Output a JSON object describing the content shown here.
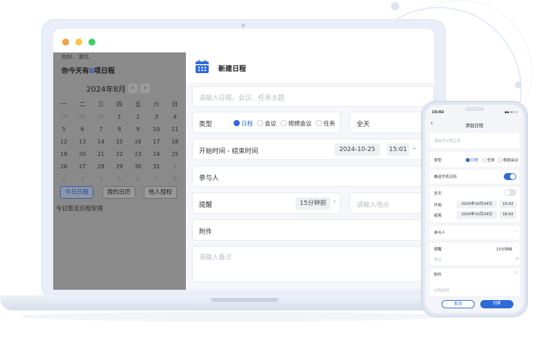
{
  "laptop": {
    "left": {
      "greeting": "你好，湘北",
      "summary_prefix": "你今天有",
      "summary_count": "0",
      "summary_suffix": "项日程",
      "month_title": "2024年8月",
      "weekdays": [
        "一",
        "二",
        "三",
        "四",
        "五",
        "六",
        "日"
      ],
      "days": [
        [
          "29",
          "muted"
        ],
        [
          "30",
          "muted"
        ],
        [
          "31",
          "muted"
        ],
        [
          "1",
          ""
        ],
        [
          "2",
          ""
        ],
        [
          "3",
          ""
        ],
        [
          "4",
          ""
        ],
        [
          "5",
          ""
        ],
        [
          "6",
          ""
        ],
        [
          "7",
          ""
        ],
        [
          "8",
          ""
        ],
        [
          "9",
          ""
        ],
        [
          "10",
          ""
        ],
        [
          "11",
          ""
        ],
        [
          "12",
          ""
        ],
        [
          "13",
          ""
        ],
        [
          "14",
          ""
        ],
        [
          "15",
          ""
        ],
        [
          "16",
          ""
        ],
        [
          "17",
          ""
        ],
        [
          "18",
          ""
        ],
        [
          "19",
          ""
        ],
        [
          "20",
          ""
        ],
        [
          "21",
          ""
        ],
        [
          "22",
          ""
        ],
        [
          "23",
          ""
        ],
        [
          "24",
          ""
        ],
        [
          "25",
          ""
        ],
        [
          "26",
          ""
        ],
        [
          "27",
          ""
        ],
        [
          "28",
          ""
        ],
        [
          "29",
          ""
        ],
        [
          "30",
          ""
        ],
        [
          "31",
          ""
        ],
        [
          "1",
          "muted"
        ],
        [
          "2",
          "muted"
        ],
        [
          "3",
          "muted"
        ],
        [
          "4",
          "muted"
        ],
        [
          "5",
          "muted"
        ],
        [
          "6",
          "muted"
        ],
        [
          "7",
          "muted"
        ],
        [
          "8",
          "muted"
        ]
      ],
      "buttons": {
        "today": "今日日程",
        "mine": "我的日历",
        "others": "他人授权"
      },
      "empty_text": "今日暂无日程安排"
    },
    "form": {
      "title": "新建日程",
      "subject_placeholder": "请输入日程、会议、任务主题",
      "type_label": "类型",
      "type_options": {
        "schedule": "日程",
        "meeting": "会议",
        "video": "视频会议",
        "task": "任务"
      },
      "allday_label": "全天",
      "time_label": "开始时间 - 结束时间",
      "start_date": "2024-10-25",
      "start_time": "15:01",
      "time_sep": "-",
      "participants_label": "参与人",
      "reminder_label": "提醒",
      "reminder_value": "15分钟前",
      "location_placeholder": "请输入地点",
      "attachment_label": "附件",
      "notes_placeholder": "请输入备注"
    }
  },
  "phone": {
    "status_time": "15:02",
    "status_icons": "▪▪ ≋ ▭",
    "back_icon": "‹",
    "title": "添加日程",
    "subject_placeholder": "请填写日程主题",
    "type_label": "类型",
    "type_options": {
      "schedule": "日程",
      "task": "任务",
      "video": "视频会议"
    },
    "sync_label": "推送手机日历",
    "allday_label": "全天",
    "start_label": "开始",
    "start_date": "2024年10月24日",
    "start_time": "15:02",
    "end_label": "结束",
    "end_date": "2024年10月24日",
    "end_time": "16:02",
    "participants_label": "参与人",
    "reminder_label": "提醒",
    "reminder_value": "15分钟前",
    "location_placeholder": "地点",
    "attachment_label": "附件",
    "notes_placeholder": "日程说明",
    "cancel_label": "取消",
    "create_label": "创建"
  },
  "colors": {
    "accent": "#2f6ad9",
    "dim_overlay": "#8a8a8a"
  }
}
